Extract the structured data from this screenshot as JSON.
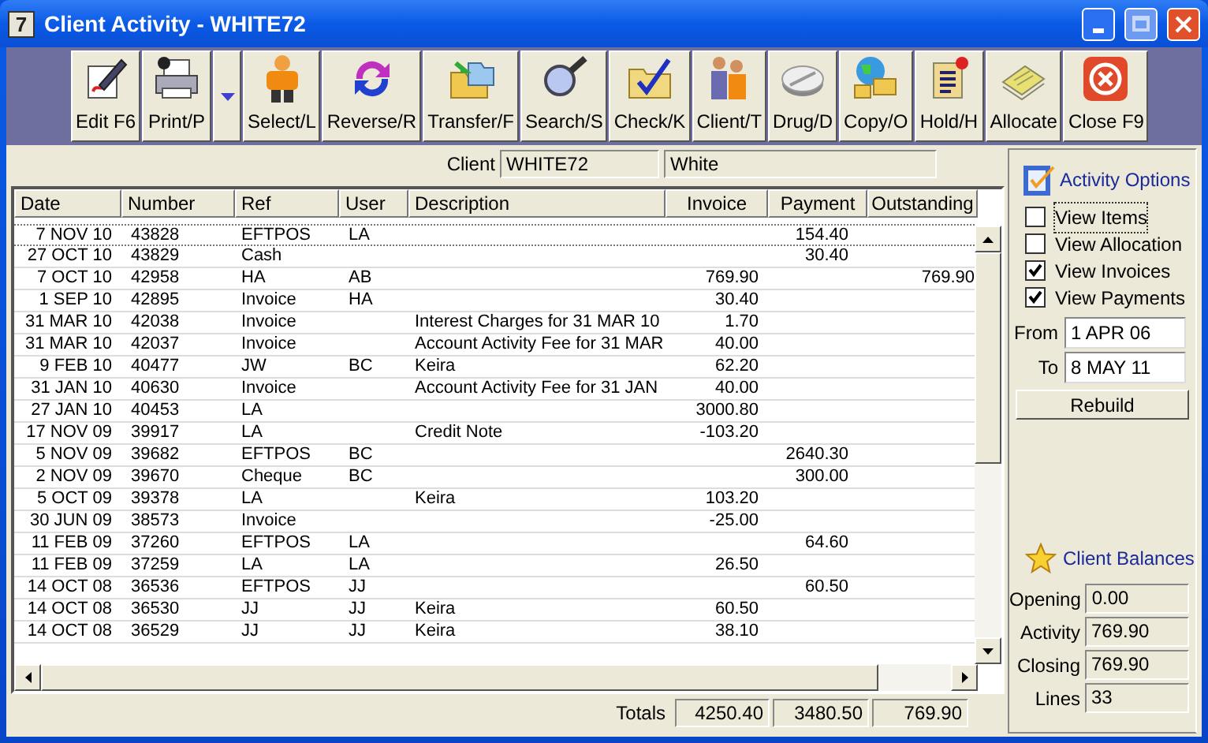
{
  "window": {
    "app_icon": "7",
    "title": "Client Activity - WHITE72"
  },
  "toolbar": [
    {
      "label": "Edit F6",
      "kind": "edit"
    },
    {
      "label": "Print/P",
      "kind": "print",
      "has_menu": true
    },
    {
      "label": "Select/L",
      "kind": "person"
    },
    {
      "label": "Reverse/R",
      "kind": "reverse"
    },
    {
      "label": "Transfer/F",
      "kind": "folders"
    },
    {
      "label": "Search/S",
      "kind": "search"
    },
    {
      "label": "Check/K",
      "kind": "check"
    },
    {
      "label": "Client/T",
      "kind": "people"
    },
    {
      "label": "Drug/D",
      "kind": "pill"
    },
    {
      "label": "Copy/O",
      "kind": "copy"
    },
    {
      "label": "Hold/H",
      "kind": "hold"
    },
    {
      "label": "Allocate",
      "kind": "allocate"
    },
    {
      "label": "Close F9",
      "kind": "close"
    }
  ],
  "client": {
    "label": "Client",
    "code": "WHITE72",
    "name": "White"
  },
  "table": {
    "columns": [
      "Date",
      "Number",
      "Ref",
      "User",
      "Description",
      "Invoice",
      "Payment",
      "Outstanding"
    ],
    "rows": [
      {
        "selected": true,
        "cells": [
          "7 NOV 10",
          "43828",
          "EFTPOS",
          "LA",
          "",
          "",
          "154.40",
          ""
        ]
      },
      {
        "selected": false,
        "cells": [
          "27 OCT 10",
          "43829",
          "Cash",
          "",
          "",
          "",
          "30.40",
          ""
        ]
      },
      {
        "selected": false,
        "cells": [
          "7 OCT 10",
          "42958",
          "HA",
          "AB",
          "",
          "769.90",
          "",
          "769.90"
        ]
      },
      {
        "selected": false,
        "cells": [
          "1 SEP 10",
          "42895",
          "Invoice",
          "HA",
          "",
          "30.40",
          "",
          ""
        ]
      },
      {
        "selected": false,
        "cells": [
          "31 MAR 10",
          "42038",
          "Invoice",
          "",
          "Interest Charges for 31 MAR 10",
          "1.70",
          "",
          ""
        ]
      },
      {
        "selected": false,
        "cells": [
          "31 MAR 10",
          "42037",
          "Invoice",
          "",
          "Account Activity Fee for 31 MAR",
          "40.00",
          "",
          ""
        ]
      },
      {
        "selected": false,
        "cells": [
          "9 FEB 10",
          "40477",
          "JW",
          "BC",
          "Keira",
          "62.20",
          "",
          ""
        ]
      },
      {
        "selected": false,
        "cells": [
          "31 JAN 10",
          "40630",
          "Invoice",
          "",
          "Account Activity Fee for 31 JAN",
          "40.00",
          "",
          ""
        ]
      },
      {
        "selected": false,
        "cells": [
          "27 JAN 10",
          "40453",
          "LA",
          "",
          "",
          "3000.80",
          "",
          ""
        ]
      },
      {
        "selected": false,
        "cells": [
          "17 NOV 09",
          "39917",
          "LA",
          "",
          "Credit Note",
          "-103.20",
          "",
          ""
        ]
      },
      {
        "selected": false,
        "cells": [
          "5 NOV 09",
          "39682",
          "EFTPOS",
          "BC",
          "",
          "",
          "2640.30",
          ""
        ]
      },
      {
        "selected": false,
        "cells": [
          "2 NOV 09",
          "39670",
          "Cheque",
          "BC",
          "",
          "",
          "300.00",
          ""
        ]
      },
      {
        "selected": false,
        "cells": [
          "5 OCT 09",
          "39378",
          "LA",
          "",
          "Keira",
          "103.20",
          "",
          ""
        ]
      },
      {
        "selected": false,
        "cells": [
          "30 JUN 09",
          "38573",
          "Invoice",
          "",
          "",
          "-25.00",
          "",
          ""
        ]
      },
      {
        "selected": false,
        "cells": [
          "11 FEB 09",
          "37260",
          "EFTPOS",
          "LA",
          "",
          "",
          "64.60",
          ""
        ]
      },
      {
        "selected": false,
        "cells": [
          "11 FEB 09",
          "37259",
          "LA",
          "LA",
          "",
          "26.50",
          "",
          ""
        ]
      },
      {
        "selected": false,
        "cells": [
          "14 OCT 08",
          "36536",
          "EFTPOS",
          "JJ",
          "",
          "",
          "60.50",
          ""
        ]
      },
      {
        "selected": false,
        "cells": [
          "14 OCT 08",
          "36530",
          "JJ",
          "JJ",
          "Keira",
          "60.50",
          "",
          ""
        ]
      },
      {
        "selected": false,
        "cells": [
          "14 OCT 08",
          "36529",
          "JJ",
          "JJ",
          "Keira",
          "38.10",
          "",
          ""
        ]
      }
    ]
  },
  "totals": {
    "label": "Totals",
    "values": [
      "4250.40",
      "3480.50",
      "769.90"
    ]
  },
  "options": {
    "title": "Activity Options",
    "checkboxes": [
      {
        "label": "View Items",
        "checked": false,
        "focused": true
      },
      {
        "label": "View Allocation",
        "checked": false,
        "focused": false
      },
      {
        "label": "View Invoices",
        "checked": true,
        "focused": false
      },
      {
        "label": "View Payments",
        "checked": true,
        "focused": false
      }
    ],
    "from": {
      "label": "From",
      "value": "1 APR 06"
    },
    "to": {
      "label": "To",
      "value": "8 MAY 11"
    },
    "rebuild": "Rebuild"
  },
  "balances": {
    "title": "Client Balances",
    "fields": [
      {
        "label": "Opening",
        "value": "0.00"
      },
      {
        "label": "Activity",
        "value": "769.90"
      },
      {
        "label": "Closing",
        "value": "769.90"
      },
      {
        "label": "Lines",
        "value": "33"
      }
    ]
  }
}
